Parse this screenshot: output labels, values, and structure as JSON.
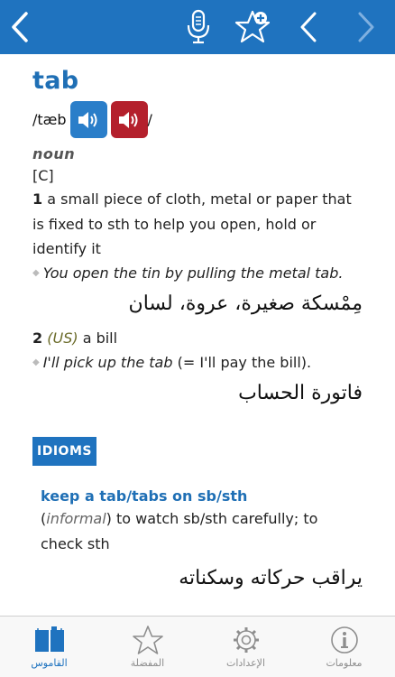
{
  "toolbar": {
    "back_icon": "chevron-left-icon",
    "mic_icon": "microphone-icon",
    "favorite_icon": "star-plus-icon",
    "prev_icon": "chevron-left-icon",
    "next_icon": "chevron-right-icon"
  },
  "entry": {
    "headword": "tab",
    "pron_open": "/tæb",
    "pron_close": "/",
    "uk_audio_icon": "speaker-icon",
    "us_audio_icon": "speaker-icon",
    "part_of_speech": "noun",
    "grammar": "[C]",
    "senses": [
      {
        "number": "1",
        "definition": "a small piece of cloth, metal or paper that is fixed to sth to help you open, hold or identify it",
        "example": "You open the tin by pulling the metal tab.",
        "translation": "مِمْسكة صغيرة، عروة، لسان"
      },
      {
        "number": "2",
        "label": "(US)",
        "definition": "a bill",
        "example": "I'll pick up the tab",
        "example_gloss": "(= I'll pay the bill).",
        "translation": "فاتورة الحساب"
      }
    ],
    "idioms_title": "IDIOMS",
    "idioms": [
      {
        "phrase": "keep a tab/tabs on sb/sth",
        "open_paren": "(",
        "register": "informal",
        "definition": ") to watch sb/sth carefully; to check sth",
        "translation": "يراقب حركاته وسكناته"
      }
    ]
  },
  "tabbar": {
    "items": [
      {
        "label": "القاموس",
        "icon": "dictionary-book-icon",
        "active": true
      },
      {
        "label": "المفضلة",
        "icon": "star-icon",
        "active": false
      },
      {
        "label": "الإعدادات",
        "icon": "gear-icon",
        "active": false
      },
      {
        "label": "معلومات",
        "icon": "info-icon",
        "active": false
      }
    ]
  },
  "colors": {
    "toolbar": "#1f73bf",
    "headword": "#1f6fb5",
    "uk_speaker": "#2a7ec9",
    "us_speaker": "#b4202c"
  }
}
